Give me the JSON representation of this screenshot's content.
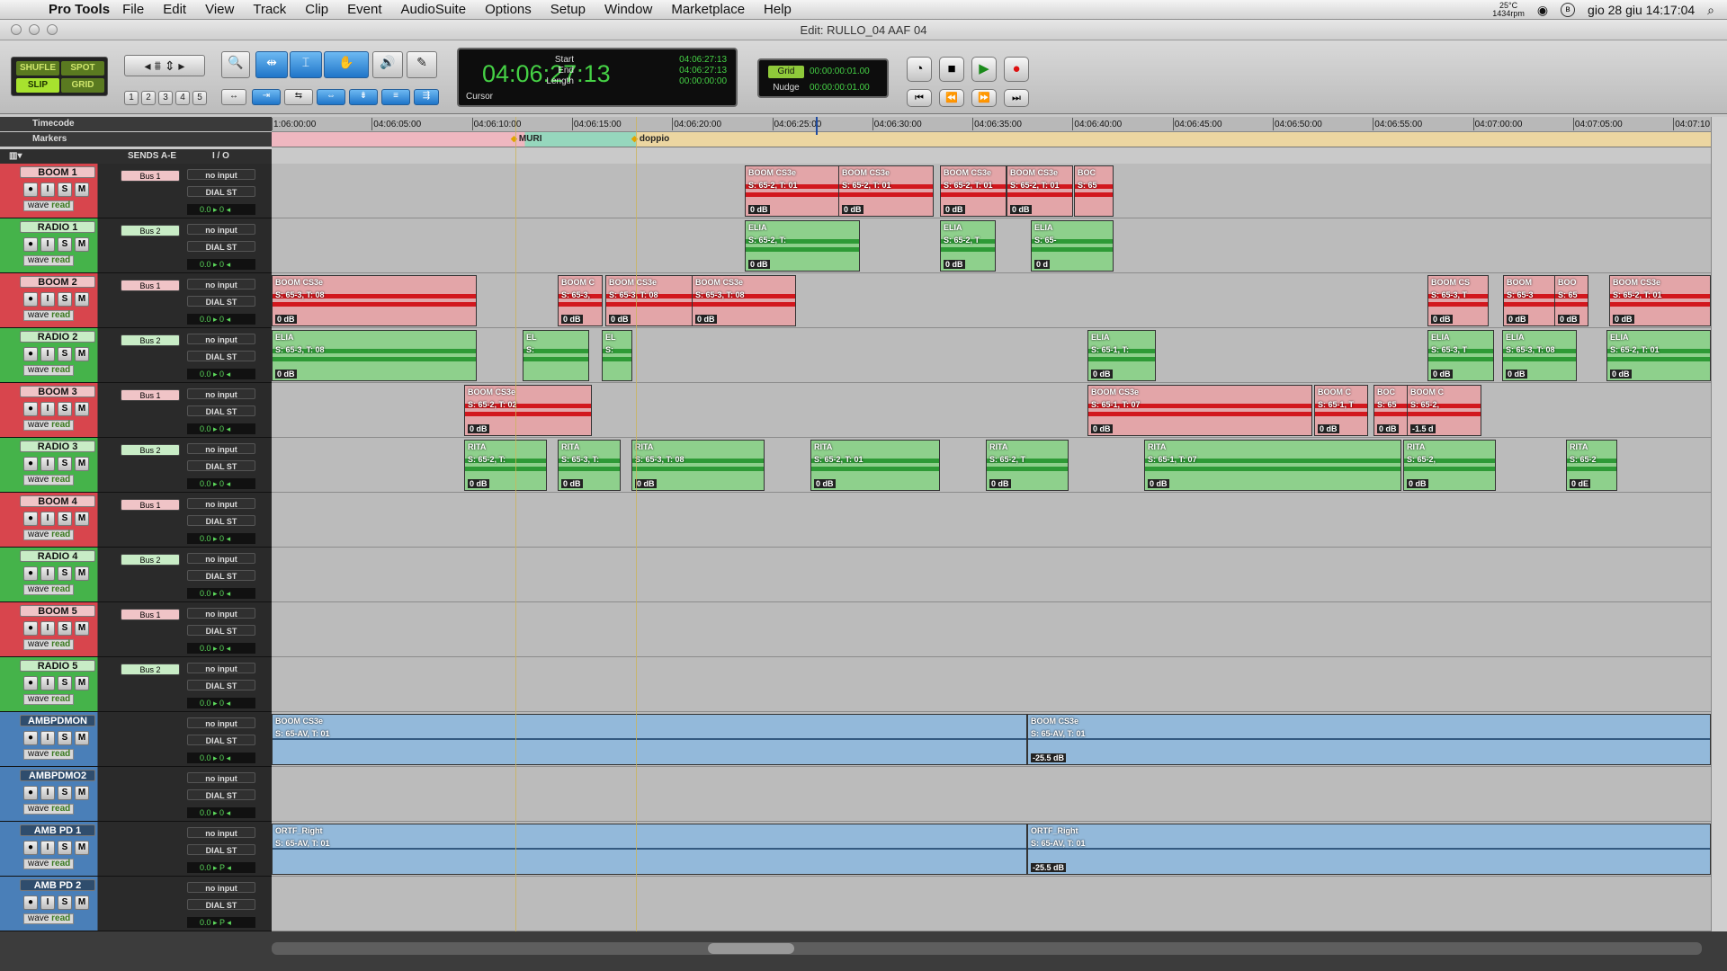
{
  "menubar": {
    "apple": "",
    "app": "Pro Tools",
    "items": [
      "File",
      "Edit",
      "View",
      "Track",
      "Clip",
      "Event",
      "AudioSuite",
      "Options",
      "Setup",
      "Window",
      "Marketplace",
      "Help"
    ],
    "temp": "25°C",
    "rpm": "1434rpm",
    "clock": "gio 28 giu  14:17:04"
  },
  "window": {
    "title": "Edit: RULLO_04 AAF 04"
  },
  "modes": {
    "shuffle": "SHUFLE",
    "spot": "SPOT",
    "slip": "SLIP",
    "grid": "GRID"
  },
  "zoom_presets": [
    "1",
    "2",
    "3",
    "4",
    "5"
  ],
  "counter": {
    "main": "04:06:27:13",
    "start_label": "Start",
    "start": "04:06:27:13",
    "end_label": "End",
    "end": "04:06:27:13",
    "length_label": "Length",
    "length": "00:00:00:00",
    "cursor_label": "Cursor"
  },
  "grid": {
    "grid_label": "Grid",
    "grid_value": "00:00:00:01.00",
    "nudge_label": "Nudge",
    "nudge_value": "00:00:00:01.00"
  },
  "rulers": {
    "timecode": "Timecode",
    "markers": "Markers",
    "ticks": [
      "1:06:00:00",
      "04:06:05:00",
      "04:06:10:00",
      "04:06:15:00",
      "04:06:20:00",
      "04:06:25:00",
      "04:06:30:00",
      "04:06:35:00",
      "04:06:40:00",
      "04:06:45:00",
      "04:06:50:00",
      "04:06:55:00",
      "04:07:00:00",
      "04:07:05:00",
      "04:07:10:0"
    ],
    "marker_names": [
      "MURI",
      "doppio"
    ]
  },
  "columns": {
    "sends": "SENDS A-E",
    "io": "I / O"
  },
  "colors": {
    "boom": "#d8454d",
    "radio": "#45b34a",
    "amb": "#4a7fb8",
    "accent": "#1f75c9"
  },
  "tracks": [
    {
      "name": "BOOM 1",
      "send": "Bus 1",
      "input": "no input",
      "output": "DIAL ST",
      "vol": "0.0",
      "pan": "0",
      "type": "boom"
    },
    {
      "name": "RADIO 1",
      "send": "Bus 2",
      "input": "no input",
      "output": "DIAL ST",
      "vol": "0.0",
      "pan": "0",
      "type": "radio"
    },
    {
      "name": "BOOM 2",
      "send": "Bus 1",
      "input": "no input",
      "output": "DIAL ST",
      "vol": "0.0",
      "pan": "0",
      "type": "boom"
    },
    {
      "name": "RADIO 2",
      "send": "Bus 2",
      "input": "no input",
      "output": "DIAL ST",
      "vol": "0.0",
      "pan": "0",
      "type": "radio"
    },
    {
      "name": "BOOM 3",
      "send": "Bus 1",
      "input": "no input",
      "output": "DIAL ST",
      "vol": "0.0",
      "pan": "0",
      "type": "boom"
    },
    {
      "name": "RADIO 3",
      "send": "Bus 2",
      "input": "no input",
      "output": "DIAL ST",
      "vol": "0.0",
      "pan": "0",
      "type": "radio"
    },
    {
      "name": "BOOM 4",
      "send": "Bus 1",
      "input": "no input",
      "output": "DIAL ST",
      "vol": "0.0",
      "pan": "0",
      "type": "boom"
    },
    {
      "name": "RADIO 4",
      "send": "Bus 2",
      "input": "no input",
      "output": "DIAL ST",
      "vol": "0.0",
      "pan": "0",
      "type": "radio"
    },
    {
      "name": "BOOM 5",
      "send": "Bus 1",
      "input": "no input",
      "output": "DIAL ST",
      "vol": "0.0",
      "pan": "0",
      "type": "boom"
    },
    {
      "name": "RADIO 5",
      "send": "Bus 2",
      "input": "no input",
      "output": "DIAL ST",
      "vol": "0.0",
      "pan": "0",
      "type": "radio"
    },
    {
      "name": "AMBPDMON",
      "send": "",
      "input": "no input",
      "output": "DIAL ST",
      "vol": "0.0",
      "pan": "0",
      "type": "amb"
    },
    {
      "name": "AMBPDMO2",
      "send": "",
      "input": "no input",
      "output": "DIAL ST",
      "vol": "0.0",
      "pan": "0",
      "type": "amb"
    },
    {
      "name": "AMB PD 1",
      "send": "",
      "input": "no input",
      "output": "DIAL ST",
      "vol": "0.0",
      "pan": "P",
      "type": "amb"
    },
    {
      "name": "AMB PD 2",
      "send": "",
      "input": "no input",
      "output": "DIAL ST",
      "vol": "0.0",
      "pan": "P",
      "type": "amb"
    }
  ],
  "clips": [
    {
      "lane": 0,
      "title": "BOOM CS3e",
      "sub": "S: 65-2, T: 01",
      "db": "0 dB",
      "color": "red"
    },
    {
      "lane": 0,
      "title": "BOOM CS3e",
      "sub": "S: 65-2, T: 01",
      "db": "0 dB",
      "color": "red"
    },
    {
      "lane": 0,
      "title": "BOOM CS3e",
      "sub": "S: 65-2, T: 01",
      "db": "0 dB",
      "color": "red"
    },
    {
      "lane": 0,
      "title": "BOOM CS3e",
      "sub": "S: 65-2, T: 01",
      "db": "0 dB",
      "color": "red"
    },
    {
      "lane": 0,
      "title": "BOC",
      "sub": "S: 65",
      "db": "",
      "color": "red"
    },
    {
      "lane": 1,
      "title": "ELIA",
      "sub": "S: 65-2, T:",
      "db": "0 dB",
      "color": "green"
    },
    {
      "lane": 1,
      "title": "ELIA",
      "sub": "S: 65-2, T",
      "db": "0 dB",
      "color": "green"
    },
    {
      "lane": 1,
      "title": "ELIA",
      "sub": "S: 65-",
      "db": "0 d",
      "color": "green"
    },
    {
      "lane": 2,
      "title": "BOOM CS3e",
      "sub": "S: 65-3, T: 08",
      "db": "0 dB",
      "color": "red"
    },
    {
      "lane": 2,
      "title": "BOOM C",
      "sub": "S: 65-3,",
      "db": "0 dB",
      "color": "red"
    },
    {
      "lane": 2,
      "title": "BOOM CS3e",
      "sub": "S: 65-3, T: 08",
      "db": "0 dB",
      "color": "red"
    },
    {
      "lane": 2,
      "title": "BOOM CS3e",
      "sub": "S: 65-3, T: 08",
      "db": "0 dB",
      "color": "red"
    },
    {
      "lane": 2,
      "title": "BOOM CS",
      "sub": "S: 65-3, T",
      "db": "0 dB",
      "color": "red"
    },
    {
      "lane": 2,
      "title": "BOOM",
      "sub": "S: 65-3",
      "db": "0 dB",
      "color": "red"
    },
    {
      "lane": 2,
      "title": "BOO",
      "sub": "S: 65",
      "db": "0 dB",
      "color": "red"
    },
    {
      "lane": 2,
      "title": "BOOM CS3e",
      "sub": "S: 65-2, T: 01",
      "db": "0 dB",
      "color": "red"
    },
    {
      "lane": 3,
      "title": "ELIA",
      "sub": "S: 65-3, T: 08",
      "db": "0 dB",
      "color": "green"
    },
    {
      "lane": 3,
      "title": "EL",
      "sub": "S:",
      "db": "",
      "color": "green"
    },
    {
      "lane": 3,
      "title": "EL",
      "sub": "S:",
      "db": "",
      "color": "green"
    },
    {
      "lane": 3,
      "title": "ELIA",
      "sub": "S: 65-1, T:",
      "db": "0 dB",
      "color": "green"
    },
    {
      "lane": 3,
      "title": "ELIA",
      "sub": "S: 65-3, T",
      "db": "0 dB",
      "color": "green"
    },
    {
      "lane": 3,
      "title": "ELIA",
      "sub": "S: 65-3, T: 08",
      "db": "0 dB",
      "color": "green"
    },
    {
      "lane": 3,
      "title": "ELIA",
      "sub": "S: 65-2, T: 01",
      "db": "0 dB",
      "color": "green"
    },
    {
      "lane": 4,
      "title": "BOOM CS3e",
      "sub": "S: 65-2, T: 02",
      "db": "0 dB",
      "color": "red"
    },
    {
      "lane": 4,
      "title": "BOOM CS3e",
      "sub": "S: 65-1, T: 07",
      "db": "0 dB",
      "color": "red"
    },
    {
      "lane": 4,
      "title": "BOOM C",
      "sub": "S: 65-1, T",
      "db": "0 dB",
      "color": "red"
    },
    {
      "lane": 4,
      "title": "BOC",
      "sub": "S: 65",
      "db": "0 dB",
      "color": "red"
    },
    {
      "lane": 4,
      "title": "BOOM C",
      "sub": "S: 65-2,",
      "db": "-1.5 d",
      "color": "red"
    },
    {
      "lane": 5,
      "title": "RITA",
      "sub": "S: 65-2, T:",
      "db": "0 dB",
      "color": "green"
    },
    {
      "lane": 5,
      "title": "RITA",
      "sub": "S: 65-3, T:",
      "db": "0 dB",
      "color": "green"
    },
    {
      "lane": 5,
      "title": "RITA",
      "sub": "S: 65-3, T: 08",
      "db": "0 dB",
      "color": "green"
    },
    {
      "lane": 5,
      "title": "RITA",
      "sub": "S: 65-2, T: 01",
      "db": "0 dB",
      "color": "green"
    },
    {
      "lane": 5,
      "title": "RITA",
      "sub": "S: 65-2, T",
      "db": "0 dB",
      "color": "green"
    },
    {
      "lane": 5,
      "title": "RITA",
      "sub": "S: 65-1, T: 07",
      "db": "0 dB",
      "color": "green"
    },
    {
      "lane": 5,
      "title": "RITA",
      "sub": "S: 65-2,",
      "db": "0 dB",
      "color": "green"
    },
    {
      "lane": 5,
      "title": "RITA",
      "sub": "S: 65-2",
      "db": "0 dE",
      "color": "green"
    },
    {
      "lane": 10,
      "title": "BOOM CS3e",
      "sub": "S: 65-AV, T: 01",
      "db": "",
      "color": "blue"
    },
    {
      "lane": 10,
      "title": "BOOM CS3e",
      "sub": "S: 65-AV, T: 01",
      "db": "-25.5 dB",
      "color": "blue"
    },
    {
      "lane": 12,
      "title": "ORTF_Right",
      "sub": "S: 65-AV, T: 01",
      "db": "",
      "color": "blue"
    },
    {
      "lane": 12,
      "title": "ORTF_Right",
      "sub": "S: 65-AV, T: 01",
      "db": "-25.5 dB",
      "color": "blue"
    }
  ]
}
